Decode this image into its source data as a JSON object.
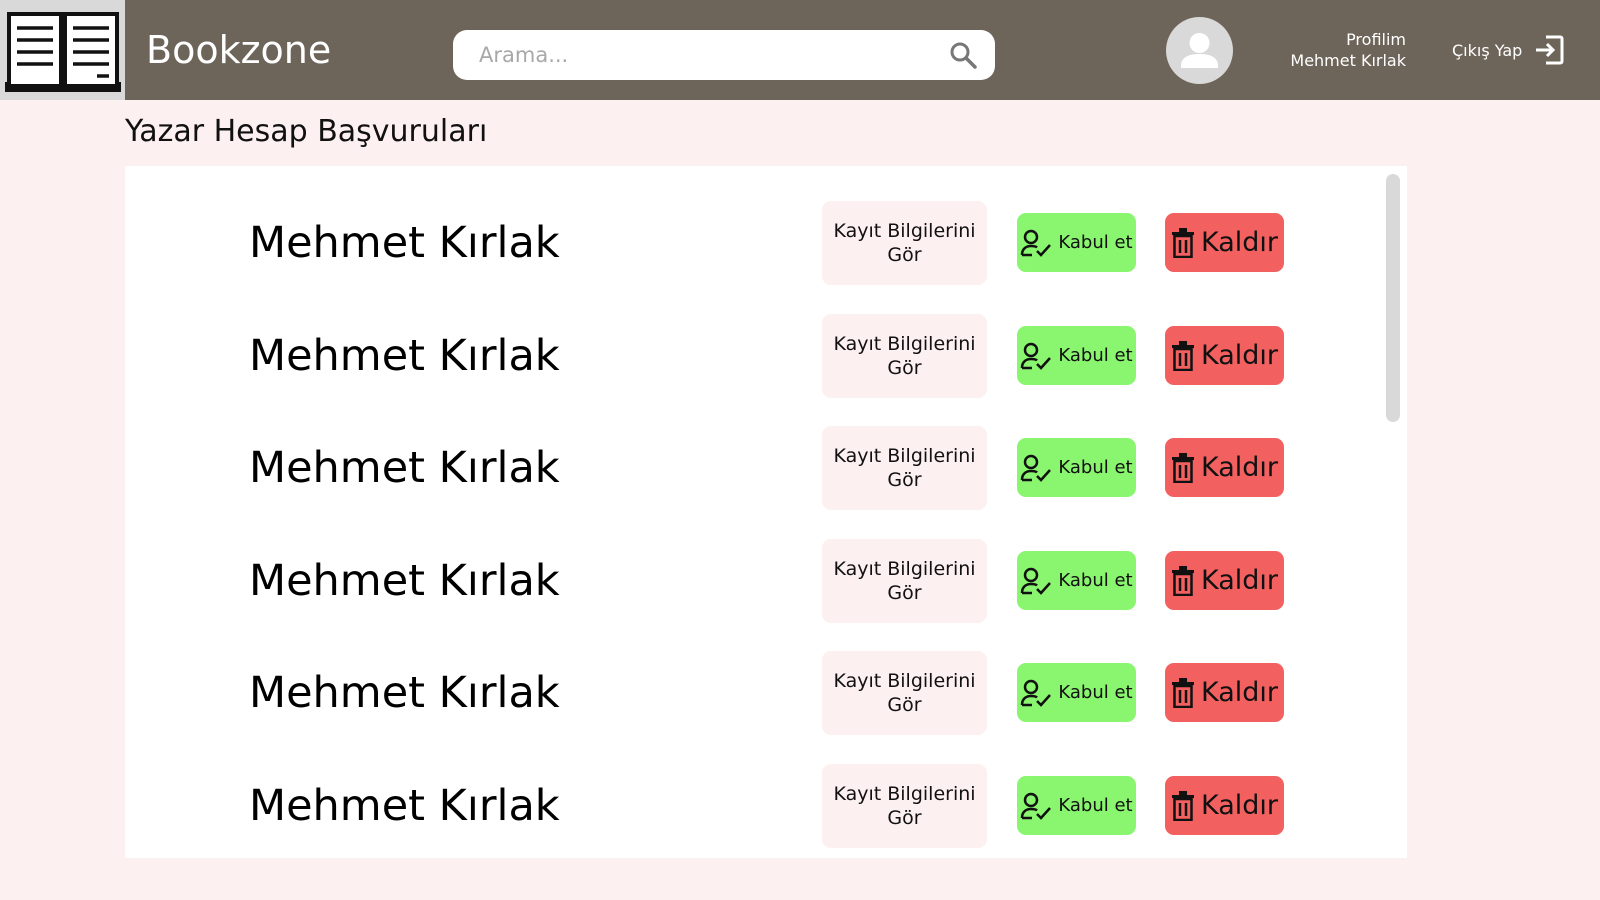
{
  "header": {
    "brand": "Bookzone",
    "search_placeholder": "Arama...",
    "profile_label": "Profilim",
    "user_name": "Mehmet Kırlak",
    "logout_label": "Çıkış Yap"
  },
  "page": {
    "title": "Yazar Hesap Başvuruları"
  },
  "applications": [
    {
      "name": "Mehmet Kırlak"
    },
    {
      "name": "Mehmet Kırlak"
    },
    {
      "name": "Mehmet Kırlak"
    },
    {
      "name": "Mehmet Kırlak"
    },
    {
      "name": "Mehmet Kırlak"
    },
    {
      "name": "Mehmet Kırlak"
    }
  ],
  "actions": {
    "view_line1": "Kayıt Bilgilerini",
    "view_line2": "Gör",
    "accept": "Kabul et",
    "remove": "Kaldır"
  },
  "colors": {
    "header_bg": "#6e655a",
    "page_bg": "#fdf0f0",
    "accept_bg": "#8af56f",
    "remove_bg": "#f26060"
  }
}
